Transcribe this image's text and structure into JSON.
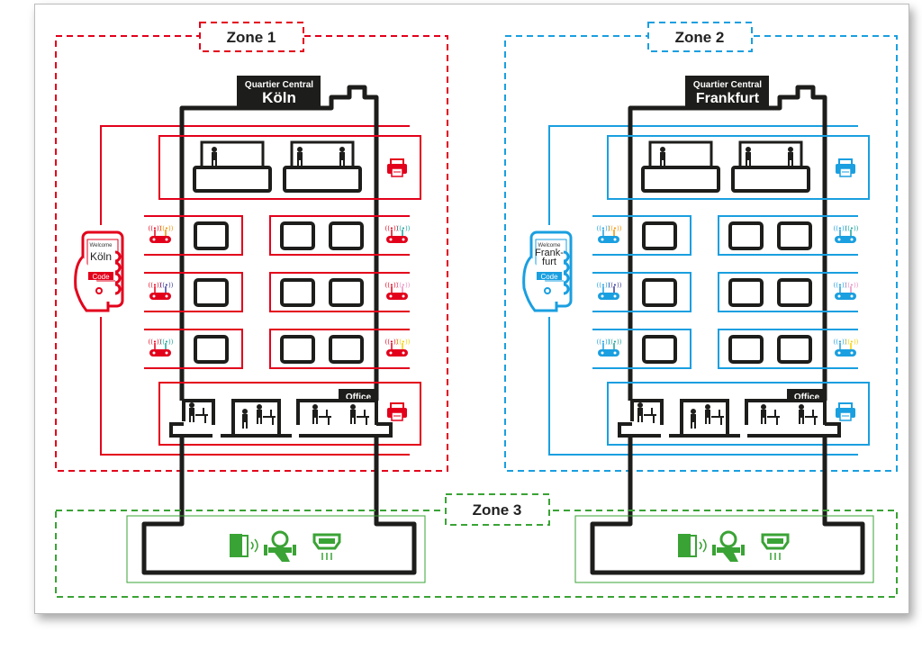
{
  "colors": {
    "zone1": "#e3001b",
    "zone2": "#1a9fe0",
    "zone3": "#3aa335",
    "building": "#1d1d1b"
  },
  "zones": [
    {
      "label": "Zone 1"
    },
    {
      "label": "Zone 2"
    },
    {
      "label": "Zone 3"
    }
  ],
  "buildings": [
    {
      "sign_top": "Quartier Central",
      "sign_city": "Köln",
      "phone_welcome": "Welcome",
      "phone_city": [
        "Köln"
      ],
      "phone_button": "Code",
      "office_label": "Office"
    },
    {
      "sign_top": "Quartier Central",
      "sign_city": "Frankfurt",
      "phone_welcome": "Welcome",
      "phone_city": [
        "Frank-",
        "furt"
      ],
      "phone_button": "Code",
      "office_label": "Office"
    }
  ],
  "icons": {
    "floor": [
      "router-icon",
      "window-icon",
      "printer-icon"
    ],
    "basement": [
      "door-sensor-icon",
      "water-meter-icon",
      "heating-icon"
    ]
  }
}
